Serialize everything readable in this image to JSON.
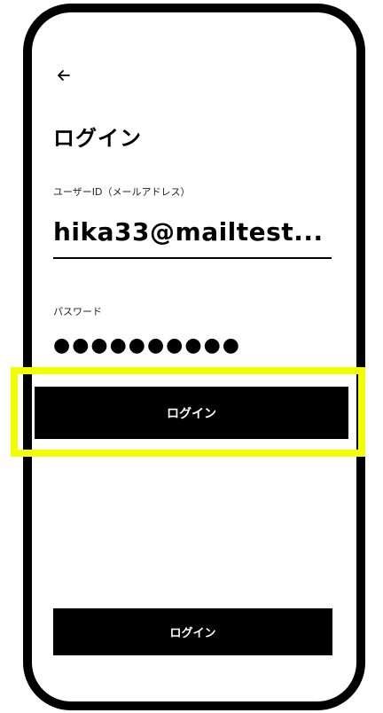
{
  "header": {
    "back_icon": "arrow-left-icon",
    "title": "ログイン"
  },
  "form": {
    "email": {
      "label": "ユーザーID（メールアドレス）",
      "value": "hika33@mailtest..."
    },
    "password": {
      "label": "パスワード",
      "value": "●●●●●●●●●●"
    }
  },
  "buttons": {
    "primary_label": "ログイン",
    "secondary_label": "ログイン"
  },
  "colors": {
    "highlight": "#f2ff00",
    "button_bg": "#000000",
    "button_text": "#ffffff",
    "frame": "#000000"
  }
}
